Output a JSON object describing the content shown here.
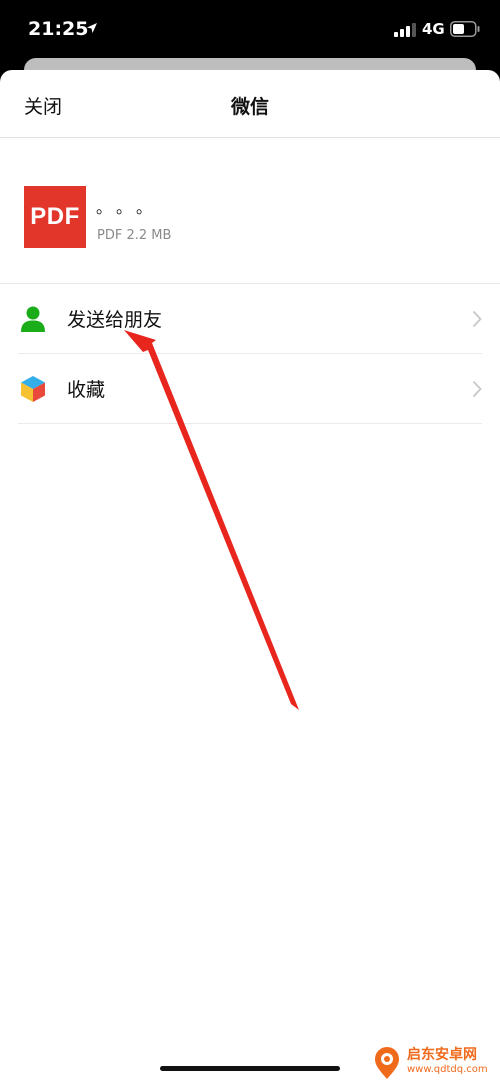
{
  "status_bar": {
    "time": "21:25",
    "network": "4G",
    "icons": [
      "location-arrow-icon",
      "signal-bars-icon",
      "battery-icon"
    ]
  },
  "nav": {
    "close_label": "关闭",
    "title": "微信"
  },
  "file": {
    "badge": "PDF",
    "name": "。。。",
    "meta": "PDF 2.2 MB"
  },
  "actions": [
    {
      "label": "发送给朋友",
      "icon": "person-icon",
      "icon_color": "#1aad19"
    },
    {
      "label": "收藏",
      "icon": "cube-icon"
    }
  ],
  "watermark": {
    "title": "启东安卓网",
    "url": "www.qdtdq.com"
  },
  "colors": {
    "pdf_red": "#e2362b",
    "arrow_red": "#e8261e",
    "friend_green": "#1aad19",
    "watermark_orange": "#f06a1c"
  }
}
